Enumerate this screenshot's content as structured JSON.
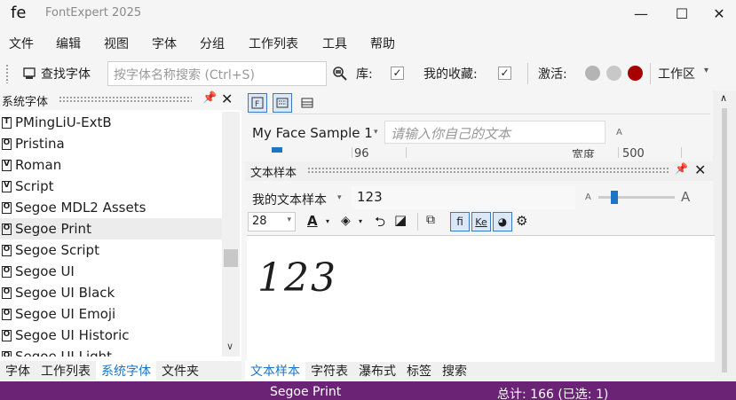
{
  "app": {
    "logo": "fe",
    "title": "FontExpert 2025"
  },
  "window_controls": {
    "minimize": "—",
    "maximize": "☐",
    "close": "✕"
  },
  "menu": [
    "文件",
    "编辑",
    "视图",
    "字体",
    "分组",
    "工作列表",
    "工具",
    "帮助"
  ],
  "toolbar": {
    "find_font": "查找字体",
    "search_placeholder": "按字体名称搜索 (Ctrl+S)",
    "library_label": "库:",
    "library_checked": "✓",
    "favorites_label": "我的收藏:",
    "favorites_checked": "✓",
    "activate_label": "激活:",
    "activate_colors": [
      "#b4b4b4",
      "#c8c8c8",
      "#a80000"
    ],
    "workspace_label": "工作区"
  },
  "left_panel": {
    "title": "系统字体",
    "fonts": [
      {
        "name": "PMingLiU-ExtB",
        "type": "T",
        "selected": false
      },
      {
        "name": "Pristina",
        "type": "O",
        "selected": false
      },
      {
        "name": "Roman",
        "type": "V",
        "selected": false
      },
      {
        "name": "Script",
        "type": "V",
        "selected": false
      },
      {
        "name": "Segoe MDL2 Assets",
        "type": "O",
        "selected": false
      },
      {
        "name": "Segoe Print",
        "type": "O",
        "selected": true
      },
      {
        "name": "Segoe Script",
        "type": "O",
        "selected": false
      },
      {
        "name": "Segoe UI",
        "type": "O",
        "selected": false
      },
      {
        "name": "Segoe UI Black",
        "type": "O",
        "selected": false
      },
      {
        "name": "Segoe UI Emoji",
        "type": "O",
        "selected": false
      },
      {
        "name": "Segoe UI Historic",
        "type": "O",
        "selected": false
      },
      {
        "name": "Segoe UI Light",
        "type": "O",
        "selected": false
      }
    ],
    "tabs": [
      {
        "label": "字体",
        "active": false
      },
      {
        "label": "工作列表",
        "active": false
      },
      {
        "label": "系统字体",
        "active": true
      },
      {
        "label": "文件夹",
        "active": false
      }
    ]
  },
  "right_panel": {
    "face_sample": "My Face Sample 1",
    "custom_text_placeholder": "请输入你自己的文本",
    "size_a_small": "A",
    "size_partial_1": "96",
    "width_label": "宽度",
    "width_partial": "500",
    "text_sample_title": "文本样本",
    "my_sample_label": "我的文本样本",
    "sample_text": "123",
    "font_size": "28",
    "sample_display": "123",
    "bottom_tabs": [
      {
        "label": "文本样本",
        "active": true
      },
      {
        "label": "字符表",
        "active": false
      },
      {
        "label": "瀑布式",
        "active": false
      },
      {
        "label": "标签",
        "active": false
      },
      {
        "label": "搜索",
        "active": false
      }
    ],
    "slider_value": 0.08
  },
  "status": {
    "font": "Segoe Print",
    "total": "总计: 166 (已选: 1)"
  }
}
